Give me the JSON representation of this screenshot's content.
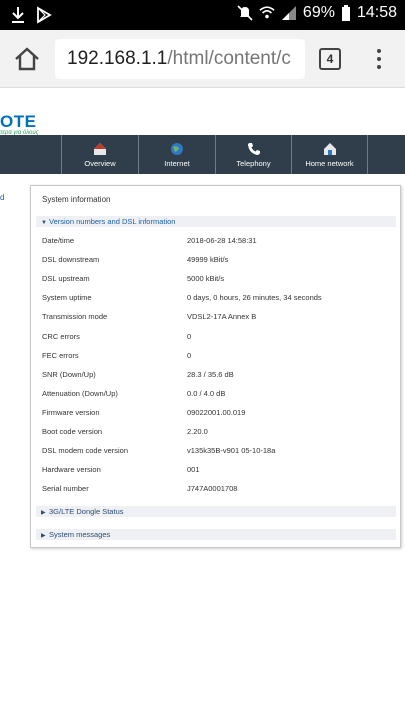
{
  "status_bar": {
    "battery": "69%",
    "time": "14:58",
    "icons": [
      "download-icon",
      "play-store-icon",
      "mute-icon",
      "wifi-icon",
      "signal-icon",
      "battery-icon"
    ]
  },
  "browser": {
    "url_host": "192.168.1.1",
    "url_path": "/html/content/c",
    "tab_count": "4",
    "icons": [
      "home-icon",
      "tabs-icon",
      "more-menu-icon"
    ]
  },
  "brand": {
    "logo_text": "OTE",
    "tagline": "τερα για όλους"
  },
  "nav": {
    "items": [
      {
        "label": "Overview",
        "icon": "house-red-icon"
      },
      {
        "label": "Internet",
        "icon": "globe-icon"
      },
      {
        "label": "Telephony",
        "icon": "phone-icon"
      },
      {
        "label": "Home network",
        "icon": "home-network-icon"
      }
    ]
  },
  "sidebar": {
    "link_fragment": "d"
  },
  "panel": {
    "title": "System information",
    "section_open": "Version numbers and DSL information",
    "rows": [
      {
        "key": "Date/time",
        "value": "2018-06-28 14:58:31"
      },
      {
        "key": "DSL downstream",
        "value": "49999 kBit/s"
      },
      {
        "key": "DSL upstream",
        "value": "5000 kBit/s"
      },
      {
        "key": "System uptime",
        "value": "0 days, 0 hours, 26 minutes, 34 seconds"
      },
      {
        "key": "Transmission mode",
        "value": "VDSL2-17A Annex B"
      },
      {
        "key": "CRC errors",
        "value": "0"
      },
      {
        "key": "FEC errors",
        "value": "0"
      },
      {
        "key": "SNR (Down/Up)",
        "value": "28.3 / 35.6 dB"
      },
      {
        "key": "Attenuation (Down/Up)",
        "value": "0.0 / 4.0 dB"
      },
      {
        "key": "Firmware version",
        "value": "09022001.00.019"
      },
      {
        "key": "Boot code version",
        "value": "2.20.0"
      },
      {
        "key": "DSL modem code version",
        "value": "v135k35B-v901 05-10-18a"
      },
      {
        "key": "Hardware version",
        "value": "001"
      },
      {
        "key": "Serial number",
        "value": "J747A0001708"
      }
    ],
    "section_dongle": "3G/LTE Dongle Status",
    "section_messages": "System messages"
  }
}
